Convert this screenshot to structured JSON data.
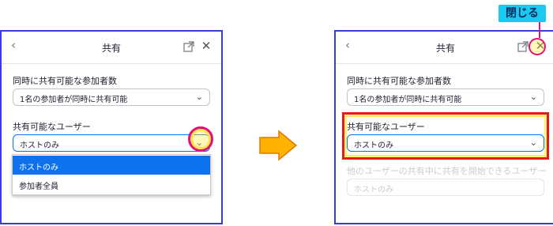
{
  "left": {
    "title": "共有",
    "section1_label": "同時に共有可能な参加者数",
    "section1_value": "1名の参加者が同時に共有可能",
    "section2_label": "共有可能なユーザー",
    "section2_value": "ホストのみ",
    "options": [
      "ホストのみ",
      "参加者全員"
    ]
  },
  "right": {
    "title": "共有",
    "section1_label": "同時に共有可能な参加者数",
    "section1_value": "1名の参加者が同時に共有可能",
    "section2_label": "共有可能なユーザー",
    "section2_value": "ホストのみ",
    "section3_label": "他のユーザーの共有中に共有を開始できるユーザー",
    "section3_value": "ホストのみ"
  },
  "callout_label": "閉じる",
  "icons": {
    "back": "chevron-left-icon",
    "popout": "popout-icon",
    "close": "close-icon",
    "chevron": "chevron-down-icon",
    "arrow": "right-arrow-icon"
  },
  "colors": {
    "accent": "#0e72ed",
    "highlight_pink": "#e4107a",
    "highlight_red": "#e61a1a",
    "highlight_yellow": "#ffe74a",
    "callout_bg": "#19c9f0",
    "arrow_fill": "#ffb300"
  }
}
